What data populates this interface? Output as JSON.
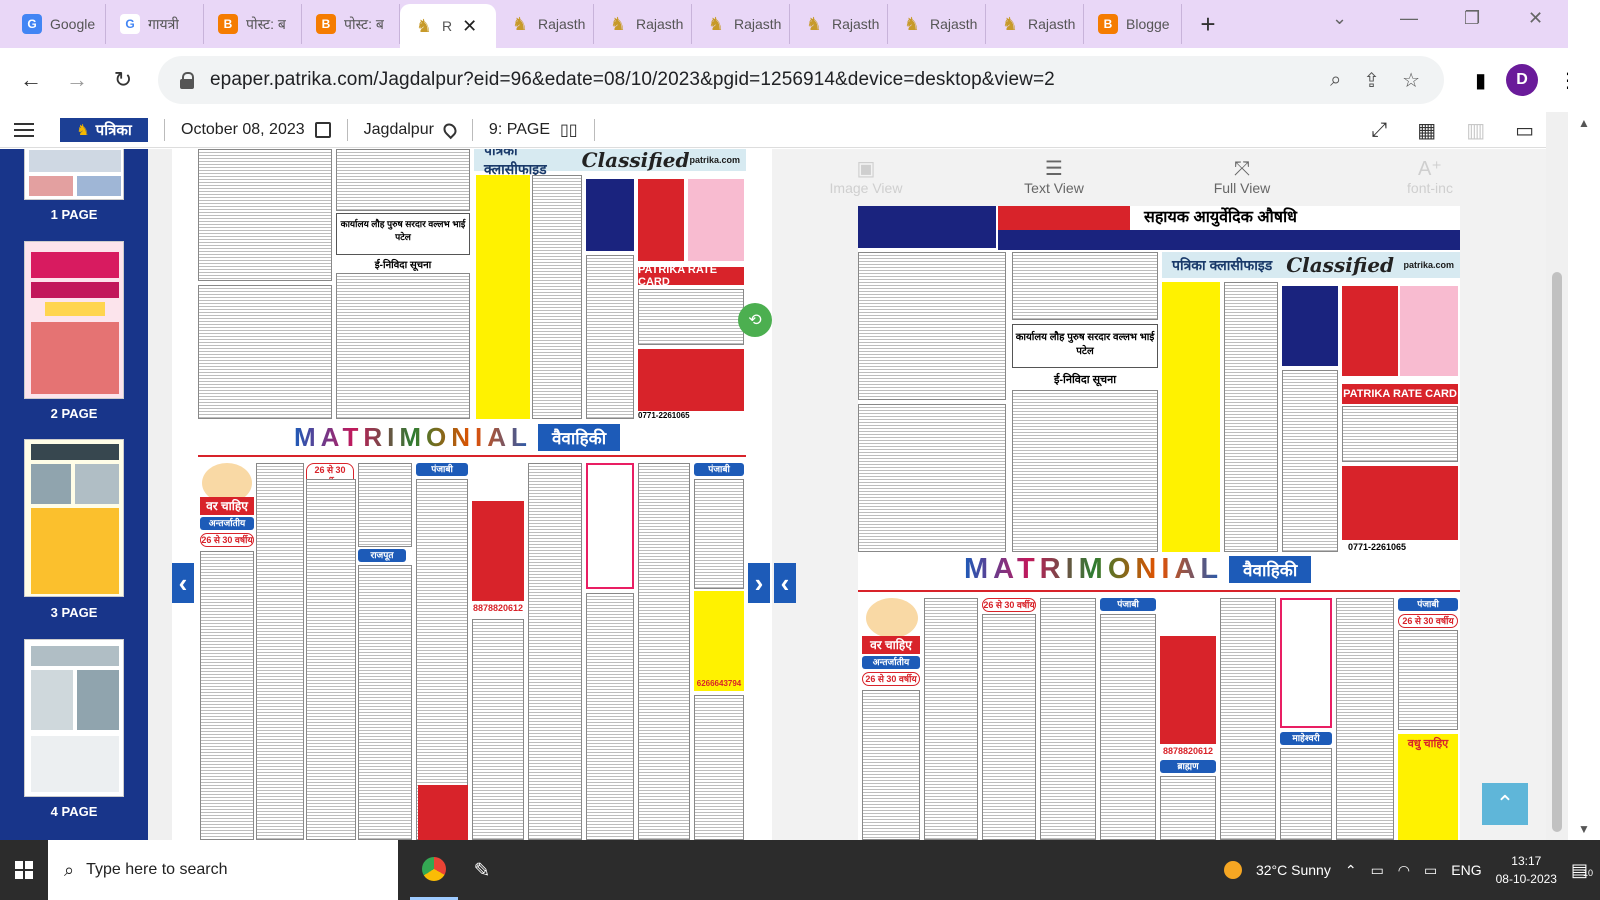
{
  "browser": {
    "tabs": [
      {
        "title": "Google",
        "icon": "google-docs-icon",
        "color": "#4285f4"
      },
      {
        "title": "गायत्री",
        "icon": "google-icon",
        "color": "#ffffff"
      },
      {
        "title": "पोस्ट: ब",
        "icon": "blogger-icon",
        "color": "#f57c00"
      },
      {
        "title": "पोस्ट: ब",
        "icon": "blogger-icon",
        "color": "#f57c00"
      },
      {
        "title": "R",
        "icon": "patrika-lion-icon",
        "color": "#c79a2a",
        "active": true
      },
      {
        "title": "Rajasth",
        "icon": "patrika-lion-icon",
        "color": "#c79a2a"
      },
      {
        "title": "Rajasth",
        "icon": "patrika-lion-icon",
        "color": "#c79a2a"
      },
      {
        "title": "Rajasth",
        "icon": "patrika-lion-icon",
        "color": "#c79a2a"
      },
      {
        "title": "Rajasth",
        "icon": "patrika-lion-icon",
        "color": "#c79a2a"
      },
      {
        "title": "Rajasth",
        "icon": "patrika-lion-icon",
        "color": "#c79a2a"
      },
      {
        "title": "Rajasth",
        "icon": "patrika-lion-icon",
        "color": "#c79a2a"
      },
      {
        "title": "Blogge",
        "icon": "blogger-icon",
        "color": "#f57c00"
      }
    ],
    "url": "epaper.patrika.com/Jagdalpur?eid=96&edate=08/10/2023&pgid=1256914&device=desktop&view=2",
    "profile_initial": "D"
  },
  "site": {
    "logo_text": "पत्रिका",
    "date": "October 08, 2023",
    "edition": "Jagdalpur",
    "page": "9: PAGE"
  },
  "thumbnails": [
    {
      "label": "1 PAGE"
    },
    {
      "label": "2 PAGE"
    },
    {
      "label": "3 PAGE"
    },
    {
      "label": "4 PAGE"
    }
  ],
  "view_modes": [
    {
      "label": "Image View",
      "icon": "image-icon",
      "enabled": false
    },
    {
      "label": "Text View",
      "icon": "text-view-icon",
      "enabled": true
    },
    {
      "label": "Full View",
      "icon": "full-view-icon",
      "enabled": true
    },
    {
      "label": "font-inc",
      "icon": "font-increase-icon",
      "enabled": false
    }
  ],
  "newspaper": {
    "classified_hi": "पत्रिका क्लासीफाइड",
    "classified_en": "Classified",
    "site_tag": "patrika.com",
    "rate_card": "PATRIKA RATE CARD",
    "matrimonial": "MATRIMONIAL",
    "matrimonial_hi": "वैवाहिकी",
    "notice_title": "ई-निविदा सूचना",
    "ayurveda_banner": "सहायक आयुर्वेदिक औषधि",
    "want_groom": "वर चाहिए",
    "want_bride": "वधु चाहिए",
    "age_tag": "26 से 30 वर्षीय",
    "caste_1": "अन्तर्जातीय",
    "caste_2": "ब्राह्मण",
    "caste_3": "राजपूत",
    "caste_4": "पंजाबी",
    "caste_5": "अग्रवाल",
    "caste_6": "कायस्थ",
    "caste_7": "माहेश्वरी",
    "phone_1": "8878820612",
    "phone_2": "6266643794",
    "phone_3": "0771-2261065"
  },
  "taskbar": {
    "search_placeholder": "Type here to search",
    "weather": "32°C  Sunny",
    "language": "ENG",
    "time": "13:17",
    "date": "08-10-2023",
    "notifications": "10"
  },
  "colors": {
    "tab_strip": "#e9d7f7",
    "thumb_sidebar": "#18358a",
    "accent_blue": "#1d5bb8",
    "news_red": "#d8232a",
    "share_green": "#4caf50",
    "top_button": "#5fb6d9",
    "taskbar": "#2c2c2c"
  }
}
